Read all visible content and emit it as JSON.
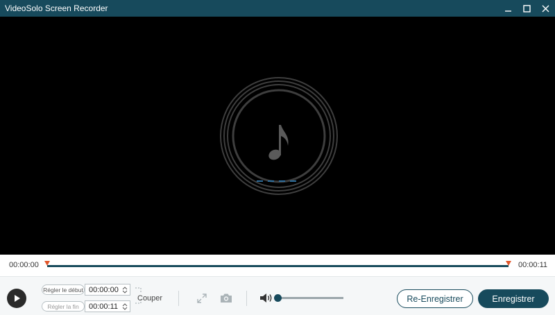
{
  "window": {
    "title": "VideoSolo Screen Recorder",
    "controls": [
      "minimize-icon",
      "maximize-icon",
      "close-icon"
    ]
  },
  "colors": {
    "titlebar": "#174a5c",
    "accent": "#174a5c",
    "marker": "#e2562a",
    "preview_bg": "#000000"
  },
  "preview": {
    "icon": "music-note-icon",
    "progress_dashes": 4
  },
  "timeline": {
    "start_time": "00:00:00",
    "end_time": "00:00:11",
    "progress": 1.0
  },
  "trim": {
    "start_label": "Régler le début",
    "start_value": "00:00:00",
    "end_label": "Régler la fin",
    "end_value": "00:00:11",
    "cut_label": "Couper"
  },
  "tools": {
    "expand_icon": "expand-icon",
    "snapshot_icon": "camera-icon"
  },
  "volume": {
    "icon": "speaker-icon",
    "level": 0.0
  },
  "actions": {
    "rerecord_label": "Re-Enregistrer",
    "save_label": "Enregistrer"
  }
}
